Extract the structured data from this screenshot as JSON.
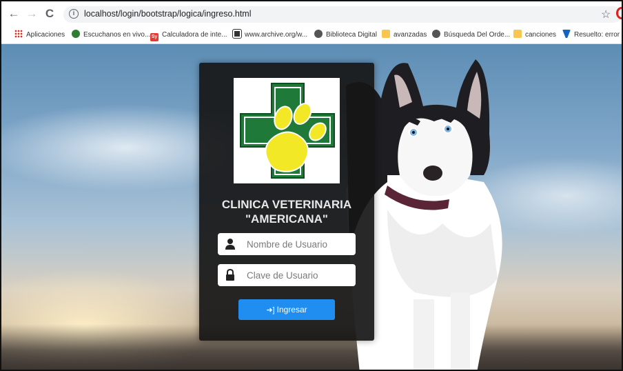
{
  "browser": {
    "url": "localhost/login/bootstrap/logica/ingreso.html",
    "nav": {
      "back": "←",
      "forward": "→",
      "reload": "C"
    },
    "bookmarks": [
      {
        "label": "Aplicaciones",
        "icon": "apps-icon",
        "color": "#d93025"
      },
      {
        "label": "Escuchanos en vivo...",
        "icon": "radio-icon",
        "color": "#2e7d32"
      },
      {
        "label": "Calculadora de inte...",
        "icon": "sy-icon",
        "color": "#e53935"
      },
      {
        "label": "www.archive.org/w...",
        "icon": "archive-icon",
        "color": "#333333"
      },
      {
        "label": "Biblioteca Digital",
        "icon": "globe-icon",
        "color": "#555555"
      },
      {
        "label": "avanzadas",
        "icon": "folder-icon",
        "color": "#f9c74f"
      },
      {
        "label": "Búsqueda Del Orde...",
        "icon": "globe-icon",
        "color": "#555555"
      },
      {
        "label": "canciones",
        "icon": "folder-icon",
        "color": "#f9c74f"
      },
      {
        "label": "Resuelto: error int",
        "icon": "ribbon-icon",
        "color": "#1565c0"
      }
    ]
  },
  "login": {
    "title_line1": "CLINICA VETERINARIA",
    "title_line2": "\"AMERICANA\"",
    "username_placeholder": "Nombre de Usuario",
    "password_placeholder": "Clave de Usuario",
    "submit_label": "Ingresar",
    "submit_color": "#1f8ef0",
    "logo": {
      "cross_color": "#1f7a3a",
      "paw_color": "#f2e826"
    }
  }
}
